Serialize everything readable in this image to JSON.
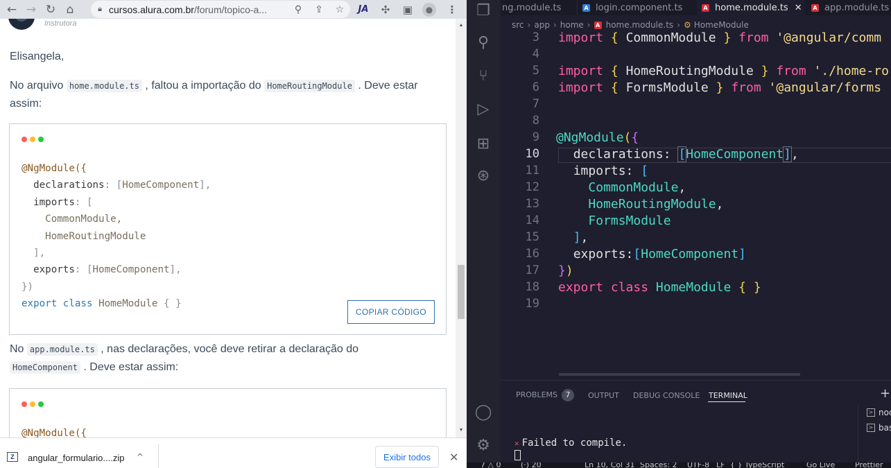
{
  "browser": {
    "url_host": "cursos.alura.com.br",
    "url_path": "/forum/topico-a...",
    "author_role": "Instrutora",
    "greeting": "Elisangela,",
    "p1_pre": "No arquivo ",
    "p1_code1": "home.module.ts",
    "p1_mid": " , faltou a importação do ",
    "p1_code2": "HomeRoutingModule",
    "p1_post": " . Deve estar assim:",
    "code_block": {
      "l1": "@NgModule({",
      "l2a": "declarations",
      "l2b": ": [",
      "l2c": "HomeComponent",
      "l2d": "],",
      "l3a": "imports",
      "l3b": ": [",
      "l4": "CommonModule,",
      "l5": "HomeRoutingModule",
      "l6": "],",
      "l7a": "exports",
      "l7b": ": [",
      "l7c": "HomeComponent",
      "l7d": "],",
      "l8": "})",
      "l9a": "export",
      "l9b": "class",
      "l9c": "HomeModule",
      "l9d": "{ }"
    },
    "copy_label": "COPIAR CÓDIGO",
    "p2_pre": "No ",
    "p2_code1": "app.module.ts",
    "p2_mid": " , nas declarações, você deve retirar a declaração do",
    "p2_code2": "HomeComponent",
    "p2_post": " . Deve estar assim:",
    "code_block2_first": "@NgModule({",
    "download": {
      "file": "angular_formulario....zip",
      "show_all": "Exibir todos"
    }
  },
  "vscode": {
    "tabs": [
      "ng.module.ts",
      "login.component.ts",
      "home.module.ts",
      "app.module.ts"
    ],
    "breadcrumb": [
      "src",
      "app",
      "home",
      "home.module.ts",
      "HomeModule"
    ],
    "line_numbers": [
      "3",
      "4",
      "5",
      "6",
      "7",
      "8",
      "9",
      "10",
      "11",
      "12",
      "13",
      "14",
      "15",
      "16",
      "17",
      "18",
      "19"
    ],
    "code": {
      "l3": [
        "import",
        "{",
        "CommonModule",
        "}",
        "from",
        "'@angular/comm"
      ],
      "l5": [
        "import",
        "{",
        "HomeRoutingModule",
        "}",
        "from",
        "'./home-ro"
      ],
      "l6": [
        "import",
        "{",
        "FormsModule",
        "}",
        "from",
        "'@angular/forms"
      ],
      "l9": [
        "@NgModule",
        "(",
        "{"
      ],
      "l10": [
        "declarations",
        ": ",
        "[",
        "HomeComponent",
        "]",
        ","
      ],
      "l11": [
        "imports",
        ": ",
        "["
      ],
      "l12": "CommonModule",
      "l13": "HomeRoutingModule",
      "l14": "FormsModule",
      "l15": [
        "]",
        ","
      ],
      "l16": [
        "exports",
        ":",
        "[",
        "HomeComponent",
        "]"
      ],
      "l17": [
        "}",
        ")"
      ],
      "l18": [
        "export",
        "class",
        "HomeModule",
        "{",
        "}"
      ]
    },
    "panel_tabs": [
      "PROBLEMS",
      "OUTPUT",
      "DEBUG CONSOLE",
      "TERMINAL"
    ],
    "problems_count": "7",
    "terminals": [
      "noc",
      "bas"
    ],
    "terminal_output": "Failed to compile.",
    "status_items": [
      "7 △ 0",
      "(·) 20",
      "Ln 10, Col 31",
      "Spaces: 2",
      "UTF-8",
      "LF",
      "{ } TypeScript",
      "Go Live",
      "Prettier"
    ]
  },
  "colors": {
    "link_blue": "#1a73e8",
    "copy_border": "#2e6fa8",
    "vscode_bg": "#1e1e2e",
    "keyword_pink": "#ff5fa8",
    "string_gold": "#f5d98a",
    "class_teal": "#4dd9c2"
  }
}
